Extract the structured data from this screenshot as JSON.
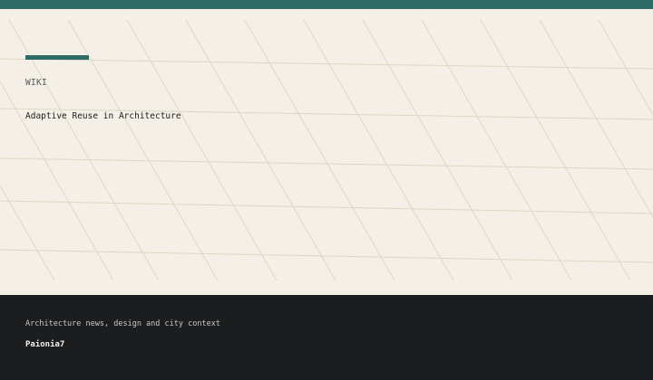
{
  "colors": {
    "accent": "#2f6b66",
    "hero_background": "#f4f0e8",
    "footer_background": "#1c1d1f",
    "pattern_line": "#dcd8c2"
  },
  "hero": {
    "category": "WIKI",
    "title": "Adaptive Reuse in Architecture"
  },
  "footer": {
    "tagline": "Architecture news, design and city context",
    "brand": "Paionia7"
  }
}
